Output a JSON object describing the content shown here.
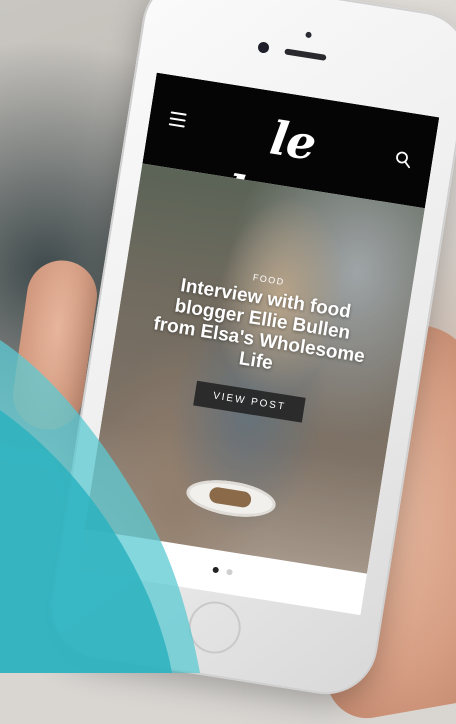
{
  "app": {
    "brand": "le buzz",
    "icons": {
      "menu": "hamburger-menu-icon",
      "search": "search-icon"
    }
  },
  "hero": {
    "category": "FOOD",
    "title": "Interview with food blogger Ellie Bullen from Elsa's Wholesome Life",
    "button_label": "VIEW POST"
  },
  "carousel": {
    "count": 2,
    "active_index": 0
  },
  "colors": {
    "header": "#050505",
    "teal": "#2bb3bf",
    "teal_light": "#5cc9d3"
  }
}
